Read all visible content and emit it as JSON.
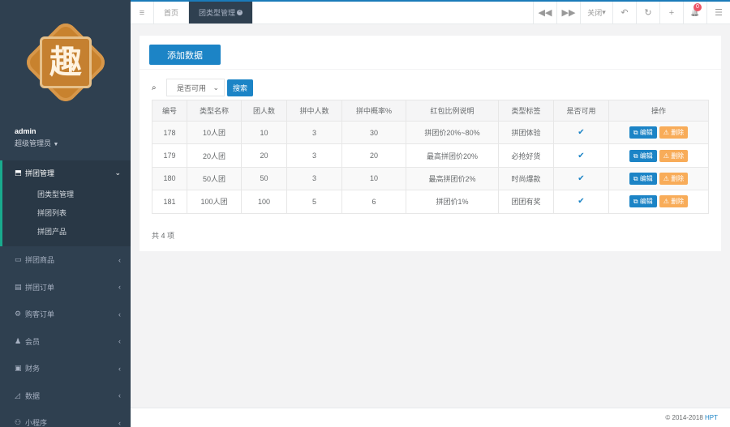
{
  "logo": {
    "char": "趣"
  },
  "profile": {
    "name": "admin",
    "role": "超级管理员"
  },
  "sidebar": {
    "active_group": {
      "icon": "⬒",
      "label": "拼团管理",
      "arrow": "⌄",
      "sub": [
        "团类型管理",
        "拼团列表",
        "拼团产品"
      ]
    },
    "items": [
      {
        "icon": "▭",
        "label": "拼团商品",
        "arrow": "‹"
      },
      {
        "icon": "▤",
        "label": "拼团订单",
        "arrow": "‹"
      },
      {
        "icon": "⚙",
        "label": "购客订单",
        "arrow": "‹"
      },
      {
        "icon": "♟",
        "label": "会员",
        "arrow": "‹"
      },
      {
        "icon": "▣",
        "label": "财务",
        "arrow": "‹"
      },
      {
        "icon": "◿",
        "label": "数据",
        "arrow": "‹"
      },
      {
        "icon": "⚇",
        "label": "小程序",
        "arrow": "‹"
      }
    ]
  },
  "topbar": {
    "menu_icon": "≡",
    "tabs": [
      {
        "label": "首页"
      },
      {
        "label": "团类型管理",
        "close": "×"
      }
    ],
    "back": "◀◀",
    "forward": "▶▶",
    "close_label": "关闭",
    "undo": "↶",
    "refresh": "↻",
    "plus": "+",
    "bell": "🔔",
    "badge": "0",
    "more": "☰"
  },
  "toolbar": {
    "add_label": "添加数据"
  },
  "search": {
    "icon": "🔍",
    "select_value": "是否可用",
    "button": "搜索"
  },
  "table": {
    "headers": [
      "编号",
      "类型名称",
      "团人数",
      "拼中人数",
      "拼中概率%",
      "红包比例说明",
      "类型标签",
      "是否可用",
      "操作"
    ],
    "rows": [
      [
        "178",
        "10人团",
        "10",
        "3",
        "30",
        "拼团价20%~80%",
        "拼团体验"
      ],
      [
        "179",
        "20人团",
        "20",
        "3",
        "20",
        "最高拼团价20%",
        "必抢好货"
      ],
      [
        "180",
        "50人团",
        "50",
        "3",
        "10",
        "最高拼团价2%",
        "时尚爆款"
      ],
      [
        "181",
        "100人团",
        "100",
        "5",
        "6",
        "拼团价1%",
        "团团有奖"
      ]
    ],
    "enabled_mark": "✔",
    "edit_label": "⧉ 编辑",
    "delete_label": "⚠ 删除"
  },
  "pagination": {
    "total": "共 4 项"
  },
  "footer": {
    "copyright": "© 2014-2018 ",
    "brand": "HPT"
  },
  "colors": {
    "primary": "#1c84c6",
    "warning": "#f8ac59",
    "sidebar": "#2f4050",
    "accent": "#19aa8d"
  }
}
